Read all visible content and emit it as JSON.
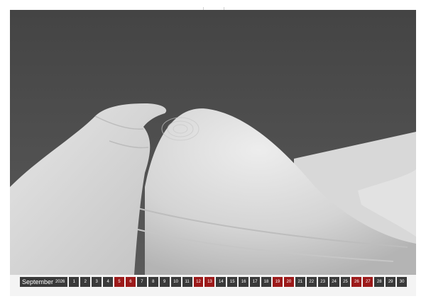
{
  "calendar": {
    "month": "September",
    "year": "2026",
    "days": [
      {
        "n": "1",
        "weekend": false
      },
      {
        "n": "2",
        "weekend": false
      },
      {
        "n": "3",
        "weekend": false
      },
      {
        "n": "4",
        "weekend": false
      },
      {
        "n": "5",
        "weekend": true
      },
      {
        "n": "6",
        "weekend": true
      },
      {
        "n": "7",
        "weekend": false
      },
      {
        "n": "8",
        "weekend": false
      },
      {
        "n": "9",
        "weekend": false
      },
      {
        "n": "10",
        "weekend": false
      },
      {
        "n": "11",
        "weekend": false
      },
      {
        "n": "12",
        "weekend": true
      },
      {
        "n": "13",
        "weekend": true
      },
      {
        "n": "14",
        "weekend": false
      },
      {
        "n": "15",
        "weekend": false
      },
      {
        "n": "16",
        "weekend": false
      },
      {
        "n": "17",
        "weekend": false
      },
      {
        "n": "18",
        "weekend": false
      },
      {
        "n": "19",
        "weekend": true
      },
      {
        "n": "20",
        "weekend": true
      },
      {
        "n": "21",
        "weekend": false
      },
      {
        "n": "22",
        "weekend": false
      },
      {
        "n": "23",
        "weekend": false
      },
      {
        "n": "24",
        "weekend": false
      },
      {
        "n": "25",
        "weekend": false
      },
      {
        "n": "26",
        "weekend": true
      },
      {
        "n": "27",
        "weekend": true
      },
      {
        "n": "28",
        "weekend": false
      },
      {
        "n": "29",
        "weekend": false
      },
      {
        "n": "30",
        "weekend": false
      }
    ]
  },
  "colors": {
    "sky": "#4a4a4a",
    "fabric": "#dcdcdc",
    "weekend": "#9c1a1a",
    "dayCell": "#3a3a3a"
  }
}
